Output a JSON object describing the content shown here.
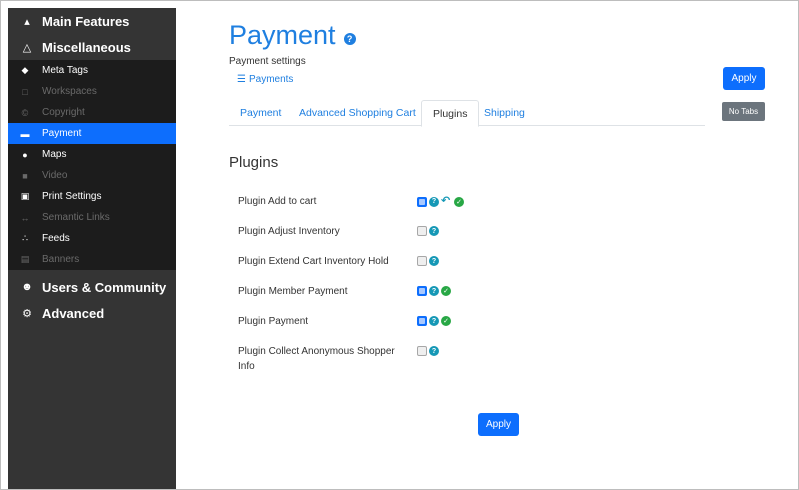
{
  "sidebar": {
    "main_top": [
      {
        "label": "Main Features",
        "icon": "bank-icon"
      },
      {
        "label": "Miscellaneous",
        "icon": "flask-icon"
      }
    ],
    "sub_items": [
      {
        "label": "Meta Tags",
        "icon": "tag-icon",
        "state": "normal"
      },
      {
        "label": "Workspaces",
        "icon": "monitor-icon",
        "state": "disabled"
      },
      {
        "label": "Copyright",
        "icon": "copyright-icon",
        "state": "disabled"
      },
      {
        "label": "Payment",
        "icon": "credit-card-icon",
        "state": "active"
      },
      {
        "label": "Maps",
        "icon": "map-marker-icon",
        "state": "normal"
      },
      {
        "label": "Video",
        "icon": "video-icon",
        "state": "disabled"
      },
      {
        "label": "Print Settings",
        "icon": "print-icon",
        "state": "normal"
      },
      {
        "label": "Semantic Links",
        "icon": "arrows-icon",
        "state": "disabled"
      },
      {
        "label": "Feeds",
        "icon": "rss-icon",
        "state": "normal"
      },
      {
        "label": "Banners",
        "icon": "film-icon",
        "state": "disabled"
      }
    ],
    "main_bottom": [
      {
        "label": "Users & Community",
        "icon": "users-icon"
      },
      {
        "label": "Advanced",
        "icon": "cogs-icon"
      }
    ]
  },
  "header": {
    "title": "Payment",
    "subtitle": "Payment settings",
    "breadcrumb": "Payments",
    "apply_label": "Apply",
    "no_tabs_label": "No Tabs"
  },
  "tabs": [
    {
      "label": "Payment",
      "active": false
    },
    {
      "label": "Advanced Shopping Cart",
      "active": false
    },
    {
      "label": "Plugins",
      "active": true
    },
    {
      "label": "Shipping",
      "active": false
    }
  ],
  "section": {
    "title": "Plugins"
  },
  "plugins": [
    {
      "label": "Plugin Add to cart",
      "checked": true,
      "has_undo": true,
      "has_ok": true
    },
    {
      "label": "Plugin Adjust Inventory",
      "checked": false,
      "has_undo": false,
      "has_ok": false
    },
    {
      "label": "Plugin Extend Cart Inventory Hold",
      "checked": false,
      "has_undo": false,
      "has_ok": false
    },
    {
      "label": "Plugin Member Payment",
      "checked": true,
      "has_undo": false,
      "has_ok": true
    },
    {
      "label": "Plugin Payment",
      "checked": true,
      "has_undo": false,
      "has_ok": true
    },
    {
      "label_line1": "Plugin Collect Anonymous Shopper",
      "label_line2": "Info",
      "checked": false,
      "has_undo": false,
      "has_ok": false
    }
  ],
  "footer": {
    "apply_label": "Apply"
  },
  "colors": {
    "accent": "#0d6efd",
    "title_blue": "#1f7fe0",
    "sidebar_bg": "#343434",
    "submenu_bg": "#1c1c1c",
    "help_teal": "#1598b6",
    "ok_green": "#28a745"
  }
}
